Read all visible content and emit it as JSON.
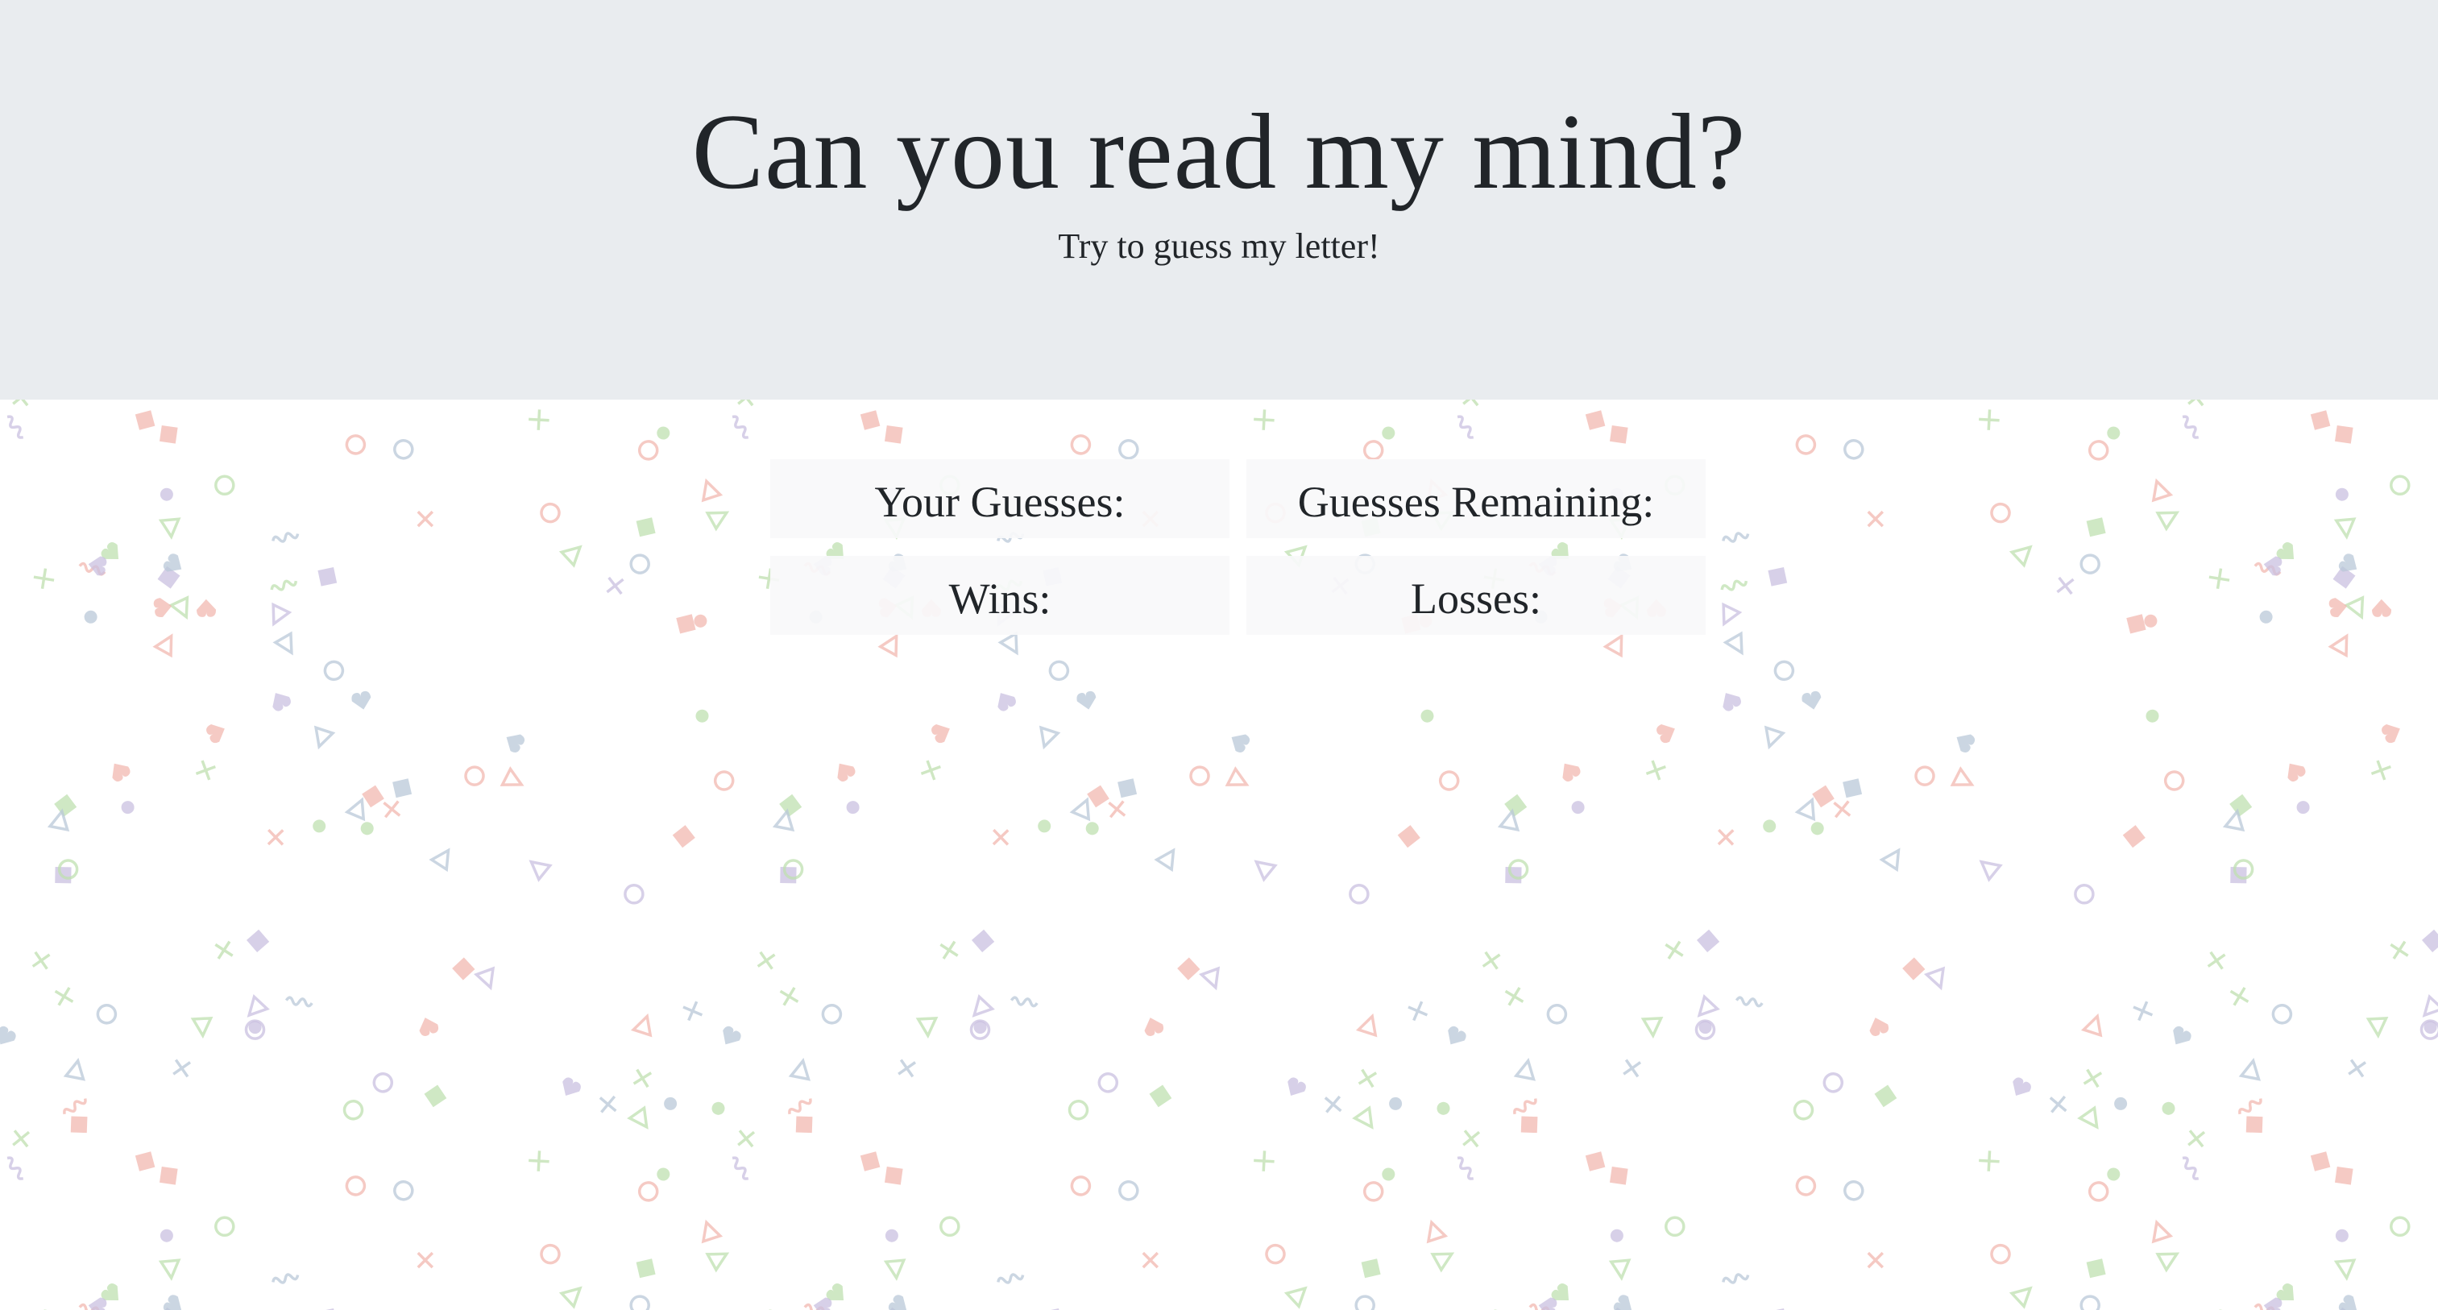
{
  "header": {
    "title": "Can you read my mind?",
    "subtitle": "Try to guess my letter!",
    "background_color": "#e9ecef"
  },
  "stats": {
    "guesses_label": "Your Guesses:",
    "remaining_label": "Guesses Remaining:",
    "wins_label": "Wins:",
    "losses_label": "Losses:",
    "box_color": "#f8f9fa"
  },
  "background_pattern": {
    "description_shapes": [
      "circle-icon",
      "triangle-icon",
      "square-icon",
      "cross-icon",
      "heart-icon",
      "squiggle-icon",
      "dot-icon"
    ],
    "colors": [
      "#f2b8b0",
      "#b9c8d8",
      "#bfe0b0",
      "#c9c0e0"
    ]
  }
}
